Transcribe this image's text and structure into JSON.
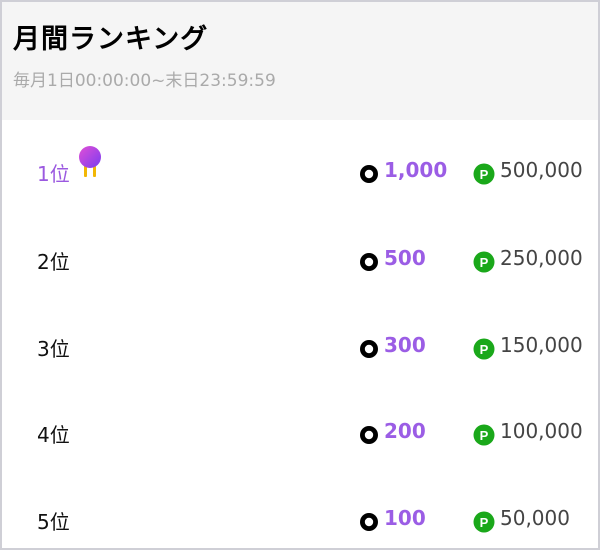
{
  "header": {
    "title": "月間ランキング",
    "period": "毎月1日00:00:00~末日23:59:59"
  },
  "colors": {
    "accent": "#9b5de5",
    "point_green": "#1aa81a",
    "header_bg": "#f5f5f5"
  },
  "rankings": [
    {
      "rank": "1位",
      "coins": "1,000",
      "points": "500,000",
      "medal_icon": "medal-icon"
    },
    {
      "rank": "2位",
      "coins": "500",
      "points": "250,000"
    },
    {
      "rank": "3位",
      "coins": "300",
      "points": "150,000"
    },
    {
      "rank": "4位",
      "coins": "200",
      "points": "100,000"
    },
    {
      "rank": "5位",
      "coins": "100",
      "points": "50,000"
    }
  ],
  "icons": {
    "coin": "coin-icon",
    "point": "point-icon",
    "point_letter": "P"
  }
}
